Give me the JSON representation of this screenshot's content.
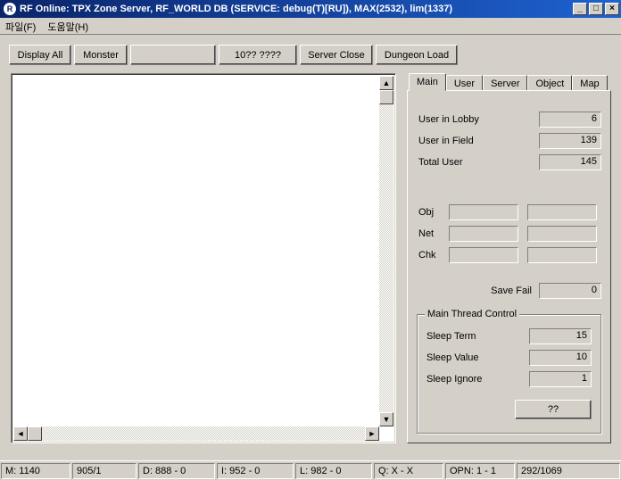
{
  "window": {
    "title": "RF Online: TPX Zone Server, RF_WORLD DB (SERVICE: debug(T)[RU]), MAX(2532), lim(1337)",
    "min_glyph": "_",
    "max_glyph": "□",
    "close_glyph": "×",
    "app_icon_glyph": "R"
  },
  "menu": {
    "file": "파일(F)",
    "help": "도움말(H)"
  },
  "toolbar": {
    "display_all": "Display All",
    "monster": "Monster",
    "blank1": "",
    "num_btn": "10?? ????",
    "server_close": "Server Close",
    "dungeon_load": "Dungeon Load"
  },
  "tabs": {
    "labels": [
      "Main",
      "User",
      "Server",
      "Object",
      "Map"
    ],
    "active_index": 0
  },
  "main_tab": {
    "user_in_lobby": {
      "label": "User in Lobby",
      "value": "6"
    },
    "user_in_field": {
      "label": "User in Field",
      "value": "139"
    },
    "total_user": {
      "label": "Total User",
      "value": "145"
    },
    "obj": {
      "label": "Obj",
      "value1": "",
      "value2": ""
    },
    "net": {
      "label": "Net",
      "value1": "",
      "value2": ""
    },
    "chk": {
      "label": "Chk",
      "value1": "",
      "value2": ""
    },
    "save_fail": {
      "label": "Save Fail",
      "value": "0"
    },
    "thread_group": {
      "title": "Main Thread Control",
      "sleep_term": {
        "label": "Sleep Term",
        "value": "15"
      },
      "sleep_value": {
        "label": "Sleep Value",
        "value": "10"
      },
      "sleep_ignore": {
        "label": "Sleep Ignore",
        "value": "1"
      },
      "apply_btn": "??"
    }
  },
  "status": {
    "c0": "M: 1140",
    "c1": "905/1",
    "c2": "D: 888 - 0",
    "c3": "I: 952 - 0",
    "c4": "L: 982 - 0",
    "c5": "Q: X - X",
    "c6": "OPN: 1 - 1",
    "c7": "292/1069"
  },
  "scroll_glyphs": {
    "up": "▲",
    "down": "▼",
    "left": "◄",
    "right": "►"
  }
}
